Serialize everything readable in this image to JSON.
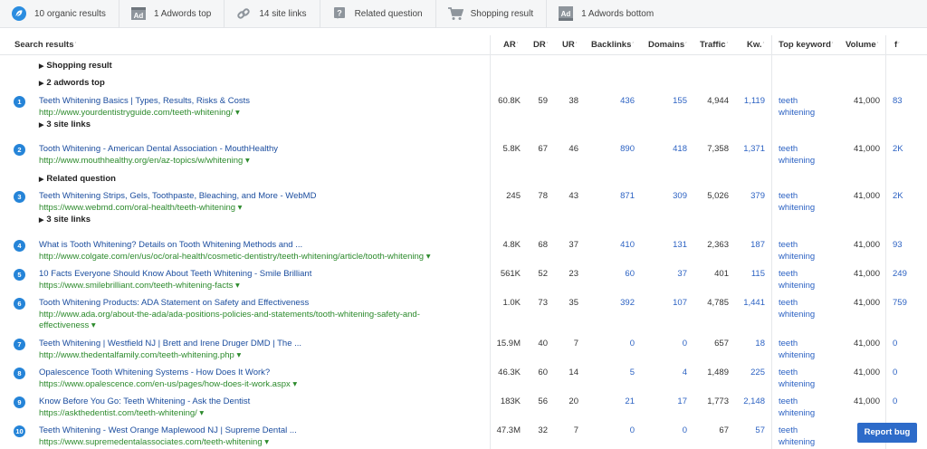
{
  "toolbar": {
    "items": [
      {
        "icon": "organic-leaf-icon",
        "label": "10 organic results"
      },
      {
        "icon": "ad-icon",
        "label": "1 Adwords top"
      },
      {
        "icon": "link-icon",
        "label": "14 site links"
      },
      {
        "icon": "question-icon",
        "label": "Related question"
      },
      {
        "icon": "shopping-cart-icon",
        "label": "Shopping result"
      },
      {
        "icon": "ad-bottom-icon",
        "label": "1 Adwords bottom"
      }
    ]
  },
  "columns": {
    "search": "Search results",
    "ar": "AR",
    "dr": "DR",
    "ur": "UR",
    "backlinks": "Backlinks",
    "domains": "Domains",
    "traffic": "Traffic",
    "kw": "Kw.",
    "topkw": "Top keyword",
    "volume": "Volume",
    "f": "f"
  },
  "groups": {
    "shopping": "Shopping result",
    "adwords": "2 adwords top",
    "related": "Related question",
    "sitelinks3": "3 site links"
  },
  "results": [
    {
      "n": "1",
      "title": "Teeth Whitening Basics | Types, Results, Risks & Costs",
      "url": "http://www.yourdentistryguide.com/teeth-whitening/",
      "ar": "60.8K",
      "dr": "59",
      "ur": "38",
      "bl": "436",
      "dom": "155",
      "tr": "4,944",
      "kw": "1,119",
      "k1": "teeth",
      "k2": "whitening",
      "vol": "41,000",
      "f": "83"
    },
    {
      "n": "2",
      "title": "Tooth Whitening - American Dental Association - MouthHealthy",
      "url": "http://www.mouthhealthy.org/en/az-topics/w/whitening",
      "ar": "5.8K",
      "dr": "67",
      "ur": "46",
      "bl": "890",
      "dom": "418",
      "tr": "7,358",
      "kw": "1,371",
      "k1": "teeth",
      "k2": "whitening",
      "vol": "41,000",
      "f": "2K"
    },
    {
      "n": "3",
      "title": "Teeth Whitening Strips, Gels, Toothpaste, Bleaching, and More - WebMD",
      "url": "https://www.webmd.com/oral-health/teeth-whitening",
      "ar": "245",
      "dr": "78",
      "ur": "43",
      "bl": "871",
      "dom": "309",
      "tr": "5,026",
      "kw": "379",
      "k1": "teeth",
      "k2": "whitening",
      "vol": "41,000",
      "f": "2K"
    },
    {
      "n": "4",
      "title": "What is Tooth Whitening? Details on Tooth Whitening Methods and ...",
      "url": "http://www.colgate.com/en/us/oc/oral-health/cosmetic-dentistry/teeth-whitening/article/tooth-whitening",
      "ar": "4.8K",
      "dr": "68",
      "ur": "37",
      "bl": "410",
      "dom": "131",
      "tr": "2,363",
      "kw": "187",
      "k1": "teeth",
      "k2": "whitening",
      "vol": "41,000",
      "f": "93"
    },
    {
      "n": "5",
      "title": "10 Facts Everyone Should Know About Teeth Whitening - Smile Brilliant",
      "url": "https://www.smilebrilliant.com/teeth-whitening-facts",
      "ar": "561K",
      "dr": "52",
      "ur": "23",
      "bl": "60",
      "dom": "37",
      "tr": "401",
      "kw": "115",
      "k1": "teeth",
      "k2": "whitening",
      "vol": "41,000",
      "f": "249"
    },
    {
      "n": "6",
      "title": "Tooth Whitening Products: ADA Statement on Safety and Effectiveness",
      "url": "http://www.ada.org/about-the-ada/ada-positions-policies-and-statements/tooth-whitening-safety-and-",
      "url2": "effectiveness",
      "ar": "1.0K",
      "dr": "73",
      "ur": "35",
      "bl": "392",
      "dom": "107",
      "tr": "4,785",
      "kw": "1,441",
      "k1": "teeth",
      "k2": "whitening",
      "vol": "41,000",
      "f": "759"
    },
    {
      "n": "7",
      "title": "Teeth Whitening | Westfield NJ | Brett and Irene Druger DMD | The ...",
      "url": "http://www.thedentalfamily.com/teeth-whitening.php",
      "ar": "15.9M",
      "dr": "40",
      "ur": "7",
      "bl": "0",
      "dom": "0",
      "tr": "657",
      "kw": "18",
      "k1": "teeth",
      "k2": "whitening",
      "vol": "41,000",
      "f": "0"
    },
    {
      "n": "8",
      "title": "Opalescence Tooth Whitening Systems - How Does It Work?",
      "url": "https://www.opalescence.com/en-us/pages/how-does-it-work.aspx",
      "ar": "46.3K",
      "dr": "60",
      "ur": "14",
      "bl": "5",
      "dom": "4",
      "tr": "1,489",
      "kw": "225",
      "k1": "teeth",
      "k2": "whitening",
      "vol": "41,000",
      "f": "0"
    },
    {
      "n": "9",
      "title": "Know Before You Go: Teeth Whitening - Ask the Dentist",
      "url": "https://askthedentist.com/teeth-whitening/",
      "ar": "183K",
      "dr": "56",
      "ur": "20",
      "bl": "21",
      "dom": "17",
      "tr": "1,773",
      "kw": "2,148",
      "k1": "teeth",
      "k2": "whitening",
      "vol": "41,000",
      "f": "0"
    },
    {
      "n": "10",
      "title": "Teeth Whitening - West Orange Maplewood NJ | Supreme Dental ...",
      "url": "https://www.supremedentalassociates.com/teeth-whitening",
      "ar": "47.3M",
      "dr": "32",
      "ur": "7",
      "bl": "0",
      "dom": "0",
      "tr": "67",
      "kw": "57",
      "k1": "teeth",
      "k2": "whitening",
      "vol": "4",
      "f": ""
    }
  ],
  "report_bug": "Report bug"
}
